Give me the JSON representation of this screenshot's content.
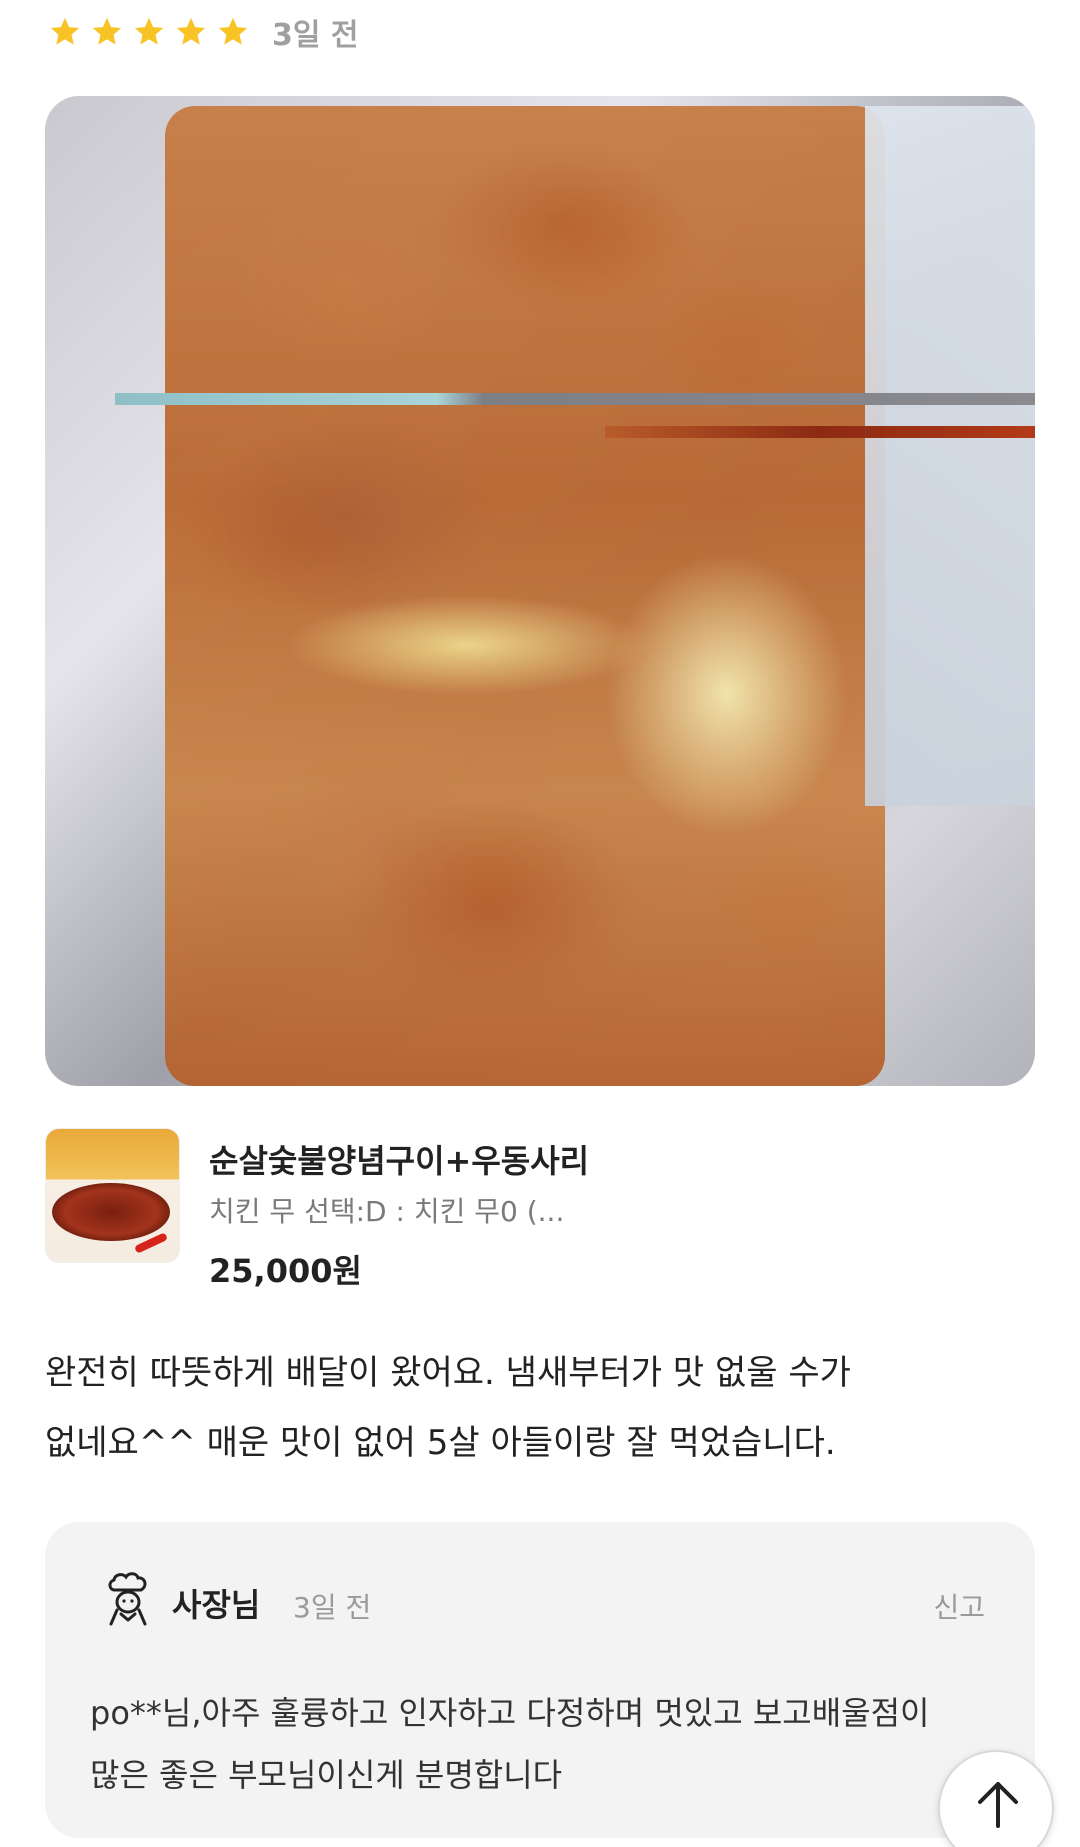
{
  "rating": {
    "stars": 5,
    "star_color": "#f7c325",
    "date": "3일 전"
  },
  "review_photo": {
    "icon": "food-photo"
  },
  "product": {
    "thumb_icon": "chicken-dish-image",
    "name": "순살숯불양념구이+우동사리",
    "option": "치킨 무 선택:D : 치킨 무0 (...",
    "price": "25,000원"
  },
  "review": {
    "text": "완전히 따뜻하게 배달이 왔어요. 냄새부터가 맛 없울 수가\n없네요^^  매운 맛이 없어 5살 아들이랑 잘 먹었습니다."
  },
  "owner_reply": {
    "icon": "chef-icon",
    "name": "사장님",
    "date": "3일 전",
    "report_label": "신고",
    "text": "po**님,아주 훌륭하고 인자하고 다정하며 멋있고 보고배울점이\n많은 좋은 부모님이신게 분명합니다"
  },
  "scroll_top": {
    "icon": "arrow-up-icon"
  }
}
